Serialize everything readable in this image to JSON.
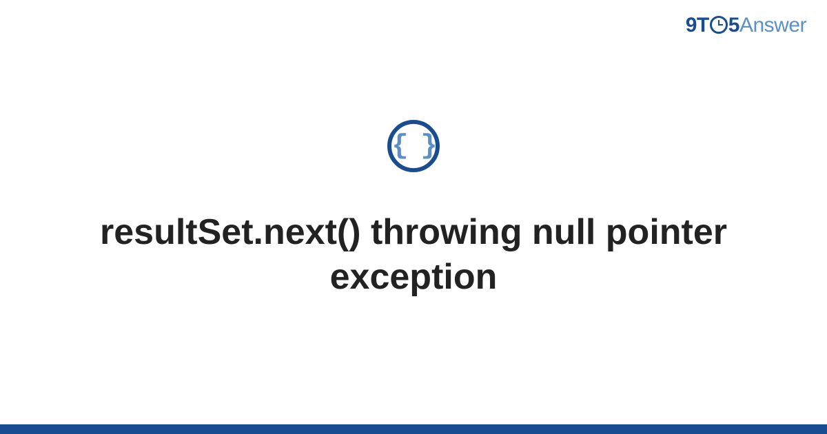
{
  "brand": {
    "part1": "9T",
    "part2": "5",
    "part3": "Answer"
  },
  "main": {
    "icon_glyph": "{ }",
    "title": "resultSet.next() throwing null pointer exception"
  }
}
